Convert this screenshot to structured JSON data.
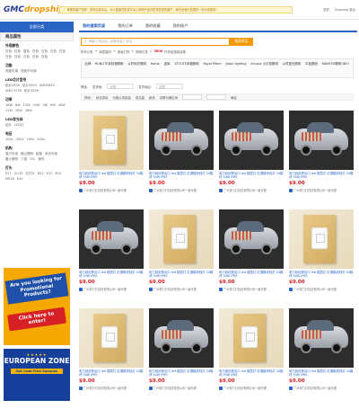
{
  "header": {
    "logo_main": "GMC",
    "logo_accent": "dropship",
    "notice": "尊敬的客户您好：您申请成功后，可以直接在批发平台上采购产品并发货给您的客户，我们全程为您提供一件代发服务！",
    "top_links": [
      "您好,",
      "Dropship 退出"
    ]
  },
  "left": {
    "tab_label": "全部分类",
    "title": "商品属性",
    "groups": [
      {
        "title": "外观颜色",
        "values": [
          "白色",
          "红色",
          "蓝色",
          "白色",
          "白色",
          "白色",
          "白色",
          "白色",
          "白色",
          "白色",
          "白色",
          "白色"
        ]
      },
      {
        "title": "功能",
        "values": [
          "亮度可调",
          "亮度不可调"
        ]
      },
      {
        "title": "LED芯片型号",
        "values": [
          "贴片2835",
          "贴片5050",
          "SMD5630",
          "SMD 5730",
          "贴片3528"
        ]
      },
      {
        "title": "功率",
        "values": [
          "18W",
          "6W",
          "12W",
          "25W",
          "3W",
          "9W",
          "45W",
          "12W",
          "25W",
          "36W"
        ]
      },
      {
        "title": "LED发光体",
        "values": [
          "贴片",
          "LED灯"
        ]
      },
      {
        "title": "电压",
        "values": [
          "100v",
          "200v",
          "100v",
          "200v"
        ]
      },
      {
        "title": "机构",
        "values": [
          "嘉兴光电",
          "佛山照明",
          "欧普",
          "永光光电",
          "雷士照明",
          "三雄",
          "TCL",
          "美的"
        ]
      },
      {
        "title": "灯头",
        "values": [
          "E27",
          "GU10",
          "无灯头",
          "B22",
          "E12",
          "B15",
          "MR16",
          "E40"
        ]
      }
    ],
    "ad1": {
      "text": "Are you looking for Promotional Products?",
      "cta": "Click here to enter!"
    },
    "ad2": {
      "stars": "★★★★★",
      "headline": "EUROPEAN ZONE",
      "sub": "Get Cash Free Samples"
    }
  },
  "nav": {
    "items": [
      "我的搜索页面",
      "我的订单",
      "我的收藏",
      "我的账户"
    ],
    "active_index": 0
  },
  "search": {
    "placeholder": "请输入商品名, 品牌或者厂家名",
    "button": "搜索商品"
  },
  "breadcrumb": {
    "parts": [
      "所有分类",
      ">",
      "家居建材",
      ">",
      "家装灯饰",
      ">",
      "照明灯具",
      ">"
    ],
    "count": "5808",
    "suffix": "件商品搜索结果"
  },
  "brands": {
    "label": "品牌:",
    "items": [
      "RUNLITE双利源照明",
      "从时间光照明",
      "Home",
      "迎辉",
      "STYLITE风格照明",
      "Royal Pitem",
      "Jason lighting",
      "chuanc 小灯泡照明",
      "从时更光照明",
      "平板照明",
      "RAINTOK照明 NEO"
    ]
  },
  "filters": {
    "label": "筛选:",
    "shipping_label": "发货地:",
    "shipping_value": "全国",
    "sort_label": "发货地区:",
    "sort_value": "全国"
  },
  "sort": {
    "items": [
      "排序:",
      "综合排序",
      "价格从低到高",
      "成交量",
      "新品",
      "设置价格区间",
      "确定"
    ]
  },
  "products": [
    {
      "type": "switch",
      "title": "电力线优势出口 led 楼层灯 红源模块线灯 24模块 50W IP65",
      "price": "$9.00",
      "seller": "广州珠力灯具技有限公司一级代理"
    },
    {
      "type": "car",
      "title": "电力线优势出口 led 楼层灯 红源模块线灯 24模块 50W IP65",
      "price": "$9.00",
      "seller": "广州珠力灯具技有限公司一级代理"
    },
    {
      "type": "car",
      "title": "电力线优势出口 led 楼层灯 红源模块线灯 24模块 50W IP65",
      "price": "$9.00",
      "seller": "广州珠力灯具技有限公司一级代理"
    },
    {
      "type": "car",
      "title": "电力线优势出口 led 楼层灯 红源模块线灯 24模块 50W IP65",
      "price": "$9.00",
      "seller": "广州珠力灯具技有限公司一级代理"
    },
    {
      "type": "car",
      "title": "电力线优势出口 led 楼层灯 红源模块线灯 24模块 50W IP65",
      "price": "$9.00",
      "seller": "广州珠力灯具技有限公司一级代理"
    },
    {
      "type": "switch",
      "title": "电力线优势出口 led 楼层灯 红源模块线灯 24模块 50W IP65",
      "price": "$9.00",
      "seller": "广州珠力灯具技有限公司一级代理"
    },
    {
      "type": "car",
      "title": "电力线优势出口 led 楼层灯 红源模块线灯 24模块 50W IP65",
      "price": "$9.00",
      "seller": "广州珠力灯具技有限公司一级代理"
    },
    {
      "type": "switch",
      "title": "电力线优势出口 led 楼层灯 红源模块线灯 24模块 50W IP65",
      "price": "$9.00",
      "seller": "广州珠力灯具技有限公司一级代理"
    },
    {
      "type": "switch",
      "title": "电力线优势出口 led 楼层灯 红源模块线灯 24模块 50W IP65",
      "price": "$9.00",
      "seller": "广州珠力灯具技有限公司一级代理"
    },
    {
      "type": "car",
      "title": "电力线优势出口 led 楼层灯 红源模块线灯 24模块 50W IP65",
      "price": "$9.00",
      "seller": "广州珠力灯具技有限公司一级代理"
    },
    {
      "type": "switch",
      "title": "电力线优势出口 led 楼层灯 红源模块线灯 24模块 50W IP65",
      "price": "$9.00",
      "seller": "广州珠力灯具技有限公司一级代理"
    },
    {
      "type": "car",
      "title": "电力线优势出口 led 楼层灯 红源模块线灯 24模块 50W IP65",
      "price": "$9.00",
      "seller": "广州珠力灯具技有限公司一级代理"
    }
  ],
  "colors": {
    "brand_blue": "#2a64c5",
    "accent_orange": "#f39800",
    "price_red": "#d71f26"
  }
}
